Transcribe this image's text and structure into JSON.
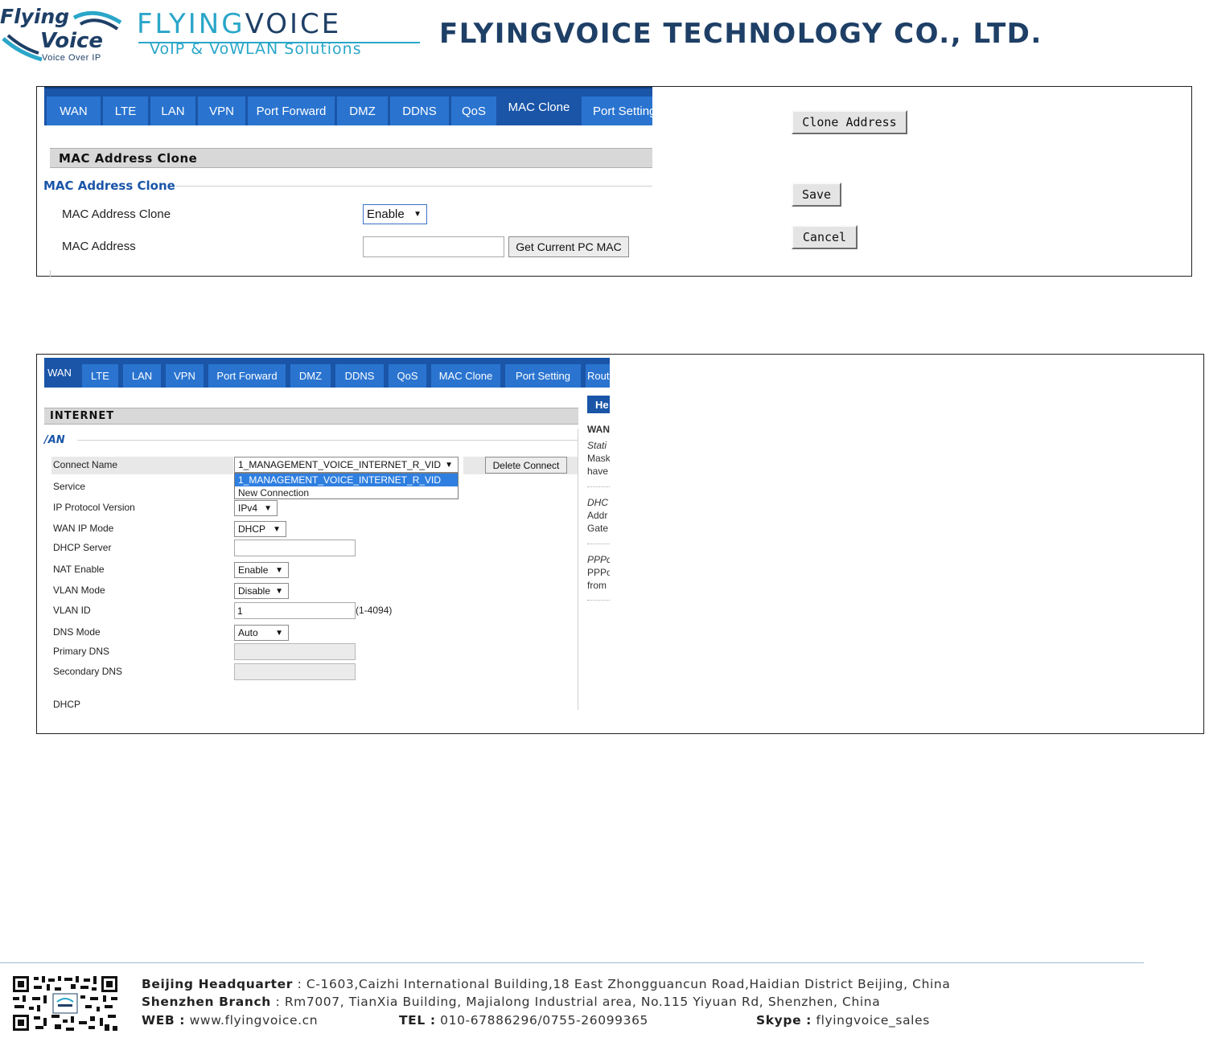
{
  "header": {
    "logo_left": {
      "line1": "Flying",
      "line2": "Voice",
      "tagline": "Voice Over IP"
    },
    "logo_right": {
      "part1": "FLYING",
      "part2": "VOICE",
      "tagline": "VoIP & VoWLAN Solutions"
    },
    "company_name": "FLYINGVOICE TECHNOLOGY CO., LTD."
  },
  "panel1": {
    "tabs": [
      "WAN",
      "LTE",
      "LAN",
      "VPN",
      "Port Forward",
      "DMZ",
      "DDNS",
      "QoS",
      "MAC Clone",
      "Port Setting"
    ],
    "active_tab": "MAC Clone",
    "section_title": "MAC Address Clone",
    "subsection_title": "MAC Address Clone",
    "fields": {
      "mac_clone_label": "MAC Address Clone",
      "mac_clone_value": "Enable",
      "mac_address_label": "MAC Address",
      "mac_address_value": "",
      "get_mac_button": "Get Current PC MAC"
    },
    "buttons": {
      "clone_address": "Clone Address",
      "save": "Save",
      "cancel": "Cancel"
    }
  },
  "panel2": {
    "tabs": [
      "WAN",
      "LTE",
      "LAN",
      "VPN",
      "Port Forward",
      "DMZ",
      "DDNS",
      "QoS",
      "MAC Clone",
      "Port Setting",
      "Rout"
    ],
    "active_tab": "WAN",
    "section_title": "INTERNET",
    "subsection_title": "/AN",
    "connect_name_label": "Connect Name",
    "connect_name_value": "1_MANAGEMENT_VOICE_INTERNET_R_VID",
    "dropdown_options": [
      "1_MANAGEMENT_VOICE_INTERNET_R_VID",
      "New Connection"
    ],
    "delete_button": "Delete Connect",
    "rows": {
      "service": {
        "label": "Service"
      },
      "ip_protocol": {
        "label": "IP Protocol Version",
        "value": "IPv4"
      },
      "wan_ip_mode": {
        "label": "WAN IP Mode",
        "value": "DHCP"
      },
      "dhcp_server": {
        "label": "DHCP Server",
        "value": ""
      },
      "nat_enable": {
        "label": "NAT Enable",
        "value": "Enable"
      },
      "vlan_mode": {
        "label": "VLAN Mode",
        "value": "Disable"
      },
      "vlan_id": {
        "label": "VLAN ID",
        "value": "1",
        "hint": "(1-4094)"
      },
      "dns_mode": {
        "label": "DNS Mode",
        "value": "Auto"
      },
      "primary_dns": {
        "label": "Primary DNS",
        "value": ""
      },
      "secondary_dns": {
        "label": "Secondary DNS",
        "value": ""
      }
    },
    "dhcp_heading": "DHCP",
    "help": {
      "head": "He",
      "wan": "WAN",
      "static_title": "Stati",
      "static_l1": "Mask",
      "static_l2": "have",
      "dhcp_title": "DHC",
      "dhcp_l1": "Addr",
      "dhcp_l2": "Gate",
      "pppoe_title": "PPPo",
      "pppoe_l1": "PPPo",
      "pppoe_l2": "from"
    }
  },
  "footer": {
    "hq_label": "Beijing Headquarter",
    "hq_sep": ":",
    "hq_address": "C-1603,Caizhi International Building,18 East Zhongguancun Road,Haidian District Beijing, China",
    "sz_label": "Shenzhen Branch",
    "sz_sep": ":",
    "sz_address": "Rm7007, TianXia Building, Majialong Industrial area, No.115 Yiyuan Rd, Shenzhen, China",
    "web_label": "WEB :",
    "web_value": "www.flyingvoice.cn",
    "tel_label": "TEL :",
    "tel_value": "010-67886296/0755-26099365",
    "skype_label": "Skype :",
    "skype_value": "flyingvoice_sales"
  },
  "colors": {
    "tab_blue": "#2a74d0",
    "tab_active": "#1a55a8",
    "brand_navy": "#1e3f66",
    "brand_cyan": "#2aa6c9",
    "select_highlight": "#2f7fe0"
  }
}
